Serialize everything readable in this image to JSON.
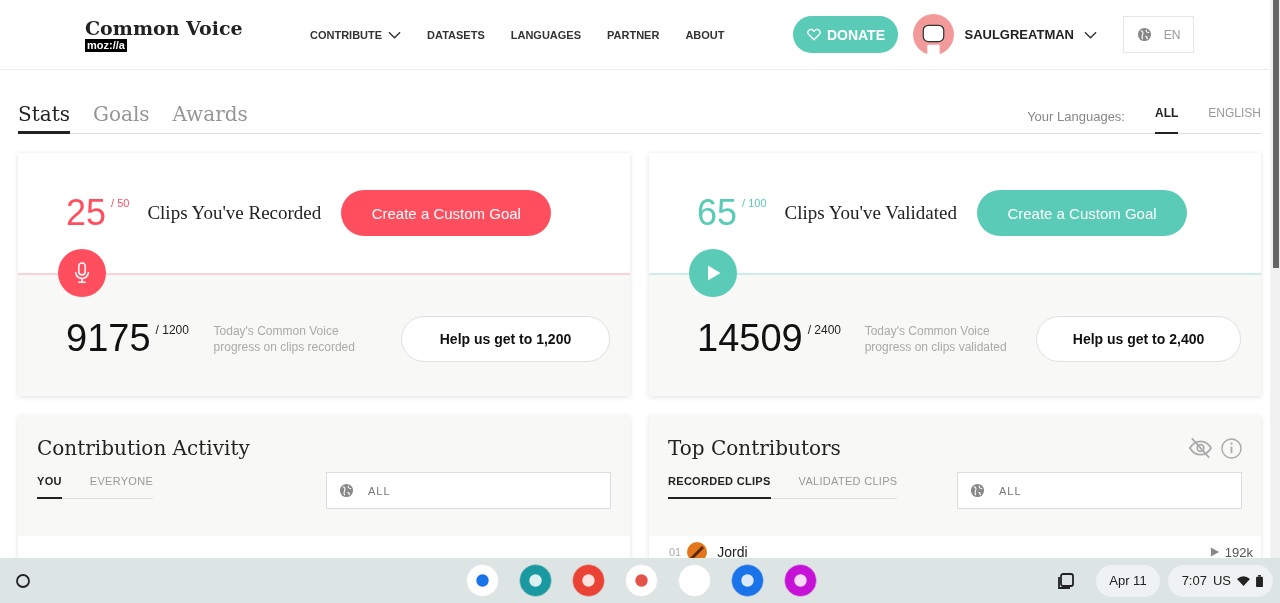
{
  "header": {
    "logo_title": "Common Voice",
    "logo_badge": "moz://a",
    "nav": [
      {
        "label": "CONTRIBUTE",
        "kind": "dropdown"
      },
      {
        "label": "DATASETS",
        "kind": "link"
      },
      {
        "label": "LANGUAGES",
        "kind": "link"
      },
      {
        "label": "PARTNER",
        "kind": "link"
      },
      {
        "label": "ABOUT",
        "kind": "link"
      }
    ],
    "donate": "DONATE",
    "username": "SAULGREATMAN",
    "language": "EN"
  },
  "tabs": [
    {
      "label": "Stats",
      "selected": true
    },
    {
      "label": "Goals",
      "selected": false
    },
    {
      "label": "Awards",
      "selected": false
    }
  ],
  "your_languages": {
    "label": "Your Languages:",
    "options": [
      {
        "label": "ALL",
        "selected": true
      },
      {
        "label": "ENGLISH",
        "selected": false
      }
    ]
  },
  "goal_cards": [
    {
      "kind": "record",
      "count": "25",
      "target": "/ 50",
      "title": "Clips You've Recorded",
      "button": "Create a Custom Goal",
      "total": "9175",
      "total_target": "/ 1200",
      "caption": "Today's Common Voice progress on clips recorded",
      "help_button": "Help us get to 1,200"
    },
    {
      "kind": "validate",
      "count": "65",
      "target": "/ 100",
      "title": "Clips You've Validated",
      "button": "Create a Custom Goal",
      "total": "14509",
      "total_target": "/ 2400",
      "caption": "Today's Common Voice progress on clips validated",
      "help_button": "Help us get to 2,400"
    }
  ],
  "activity": {
    "title": "Contribution Activity",
    "tabs": [
      {
        "label": "YOU",
        "selected": true
      },
      {
        "label": "EVERYONE",
        "selected": false
      }
    ],
    "locale": "ALL"
  },
  "contributors": {
    "title": "Top Contributors",
    "tabs": [
      {
        "label": "RECORDED CLIPS",
        "selected": true
      },
      {
        "label": "VALIDATED CLIPS",
        "selected": false
      }
    ],
    "locale": "ALL",
    "rows": [
      {
        "rank": "01",
        "name": "Jordi",
        "count": "192k"
      }
    ]
  },
  "shelf": {
    "date": "Apr 11",
    "time": "7:07",
    "region": "US"
  }
}
